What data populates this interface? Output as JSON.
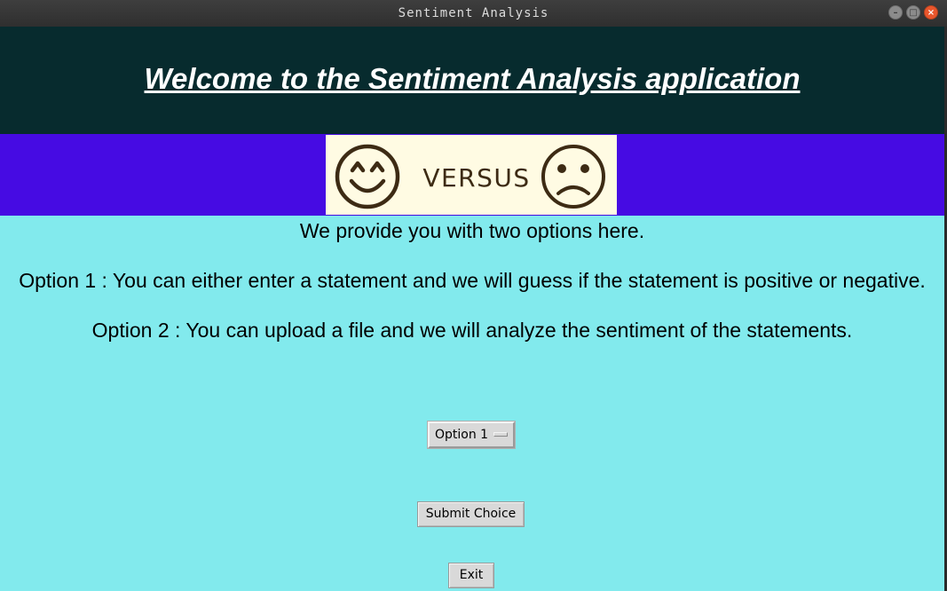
{
  "window": {
    "title": "Sentiment Analysis"
  },
  "header": {
    "title": "Welcome to the Sentiment Analysis application"
  },
  "banner": {
    "versus_text": "VERSUS",
    "left_icon": "happy-face-icon",
    "right_icon": "sad-face-icon"
  },
  "intro": {
    "line1": "We provide you with two options here.",
    "line2": "Option 1 : You can either enter a statement and we will guess if the statement is positive or negative.",
    "line3": "Option 2 : You can upload a file and we will analyze the sentiment of the statements."
  },
  "controls": {
    "option_selected": "Option 1",
    "submit_label": "Submit Choice",
    "exit_label": "Exit"
  },
  "colors": {
    "header_bg": "#072b2e",
    "banner_bg": "#460be3",
    "main_bg": "#82eaed",
    "image_bg": "#fffbe3"
  }
}
